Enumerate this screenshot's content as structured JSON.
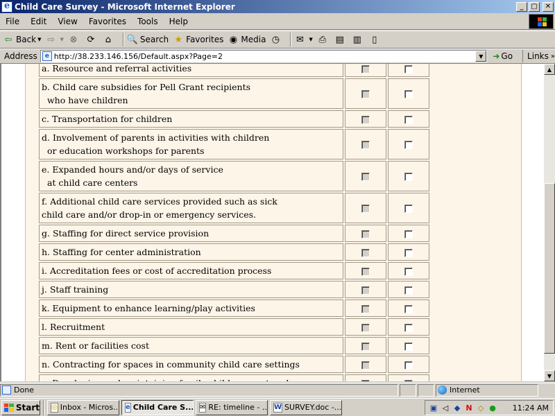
{
  "window": {
    "title": "Child Care Survey - Microsoft Internet Explorer",
    "min": "_",
    "max": "▢",
    "close": "✕"
  },
  "menu": [
    "File",
    "Edit",
    "View",
    "Favorites",
    "Tools",
    "Help"
  ],
  "toolbar": {
    "back": "Back",
    "search": "Search",
    "favorites": "Favorites",
    "media": "Media"
  },
  "address": {
    "label": "Address",
    "url": "http://38.233.146.156/Default.aspx?Page=2",
    "go": "Go",
    "links": "Links"
  },
  "survey": {
    "rows": [
      {
        "text": "a. Resource and referral activities",
        "col1": false,
        "col2": false
      },
      {
        "text": "b. Child care subsidies for Pell Grant recipients\n  who have children",
        "col1": false,
        "col2": false
      },
      {
        "text": "c. Transportation for children",
        "col1": false,
        "col2": false
      },
      {
        "text": "d. Involvement of parents in activities with children\n  or education workshops for parents",
        "col1": false,
        "col2": false
      },
      {
        "text": "e. Expanded hours and/or days of service\n  at child care centers",
        "col1": false,
        "col2": false
      },
      {
        "text": "f. Additional child care services provided such as sick\nchild care and/or drop-in or emergency services.",
        "col1": false,
        "col2": false
      },
      {
        "text": "g. Staffing for direct service provision",
        "col1": false,
        "col2": false
      },
      {
        "text": "h. Staffing for center administration",
        "col1": false,
        "col2": false
      },
      {
        "text": "i. Accreditation fees or cost of accreditation process",
        "col1": false,
        "col2": false
      },
      {
        "text": "j. Staff training",
        "col1": false,
        "col2": false
      },
      {
        "text": "k. Equipment to enhance learning/play activities",
        "col1": false,
        "col2": false
      },
      {
        "text": "l. Recruitment",
        "col1": false,
        "col2": false
      },
      {
        "text": "m. Rent or facilities cost",
        "col1": false,
        "col2": false
      },
      {
        "text": "n. Contracting for spaces in community child care settings",
        "col1": false,
        "col2": false
      },
      {
        "text": "o. Developing and maintaining family child care networks",
        "col1": false,
        "col2": false
      }
    ]
  },
  "status": {
    "text": "Done",
    "zone": "Internet"
  },
  "taskbar": {
    "start": "Start",
    "tasks": [
      "Inbox - Micros...",
      "Child Care S...",
      "RE: timeline - ...",
      "SURVEY.doc -..."
    ],
    "clock": "11:24 AM"
  }
}
